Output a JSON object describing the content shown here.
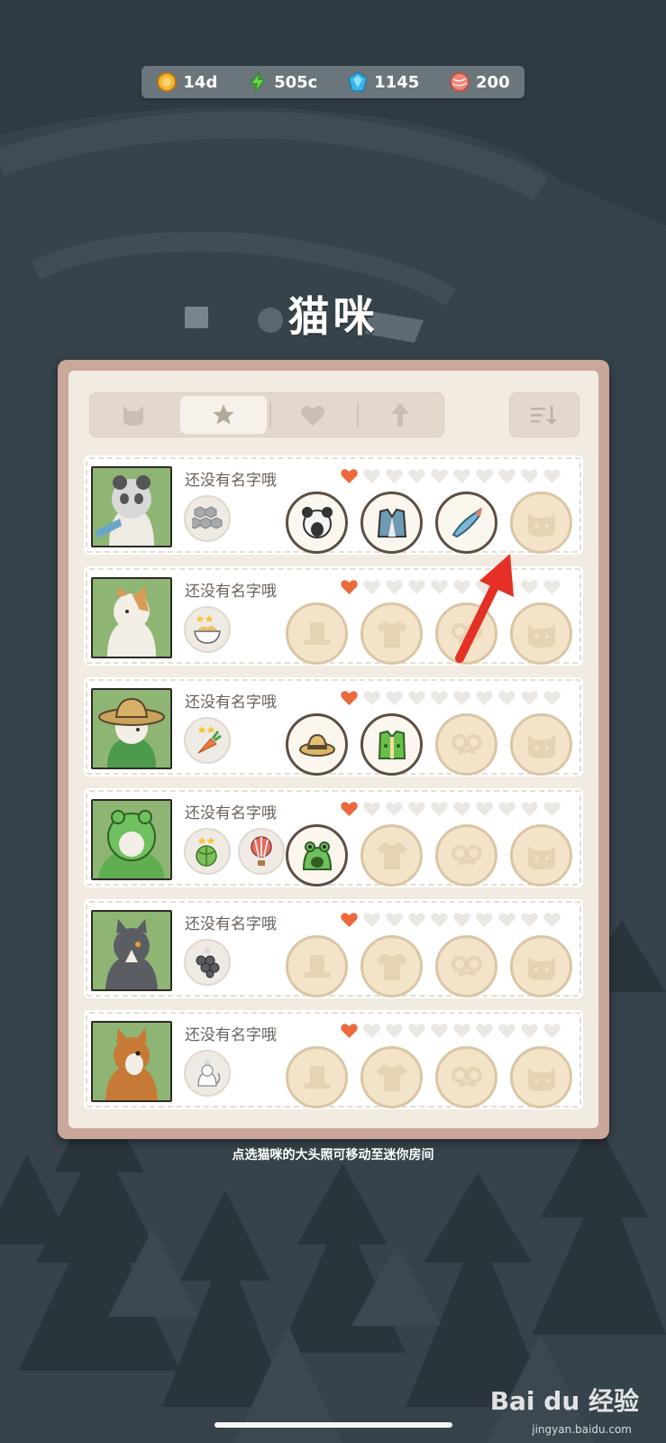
{
  "resources": [
    {
      "icon": "coin-icon",
      "value": "14d"
    },
    {
      "icon": "lightning-icon",
      "value": "505c"
    },
    {
      "icon": "gem-icon",
      "value": "1145"
    },
    {
      "icon": "yarn-icon",
      "value": "200"
    }
  ],
  "title": "猫咪",
  "tabs": [
    {
      "icon": "cat-head-icon"
    },
    {
      "icon": "star-icon",
      "active": true
    },
    {
      "icon": "heart-icon"
    },
    {
      "icon": "up-arrow-icon"
    }
  ],
  "sort_icon": "sort-icon",
  "cats": [
    {
      "name": "还没有名字哦",
      "hearts_filled": 1,
      "hearts_total": 10,
      "skills": [
        "honeycomb-icon"
      ],
      "slots": [
        "panda-hat",
        "vest",
        "fish",
        "empty-face"
      ]
    },
    {
      "name": "还没有名字哦",
      "hearts_filled": 1,
      "hearts_total": 10,
      "skills": [
        "noodle-bowl-icon"
      ],
      "slots": [
        "empty-hat",
        "empty-shirt",
        "empty-glasses",
        "empty-face"
      ]
    },
    {
      "name": "还没有名字哦",
      "hearts_filled": 1,
      "hearts_total": 10,
      "skills": [
        "carrot-icon"
      ],
      "slots": [
        "straw-hat",
        "green-vest",
        "empty-glasses",
        "empty-face"
      ]
    },
    {
      "name": "还没有名字哦",
      "hearts_filled": 1,
      "hearts_total": 10,
      "skills": [
        "cabbage-icon",
        "hot-air-balloon-icon"
      ],
      "slots": [
        "frog-hat",
        "empty-shirt",
        "empty-glasses",
        "empty-face"
      ]
    },
    {
      "name": "还没有名字哦",
      "hearts_filled": 1,
      "hearts_total": 10,
      "skills": [
        "grapes-icon"
      ],
      "slots": [
        "empty-hat",
        "empty-shirt",
        "empty-glasses",
        "empty-face"
      ]
    },
    {
      "name": "还没有名字哦",
      "hearts_filled": 1,
      "hearts_total": 10,
      "skills": [
        "white-cat-icon"
      ],
      "slots": [
        "empty-hat",
        "empty-shirt",
        "empty-glasses",
        "empty-face"
      ]
    }
  ],
  "hint": "点选猫咪的大头照可移动至迷你房间",
  "watermark": "Bai du 经验",
  "watermark_sub": "jingyan.baidu.com"
}
